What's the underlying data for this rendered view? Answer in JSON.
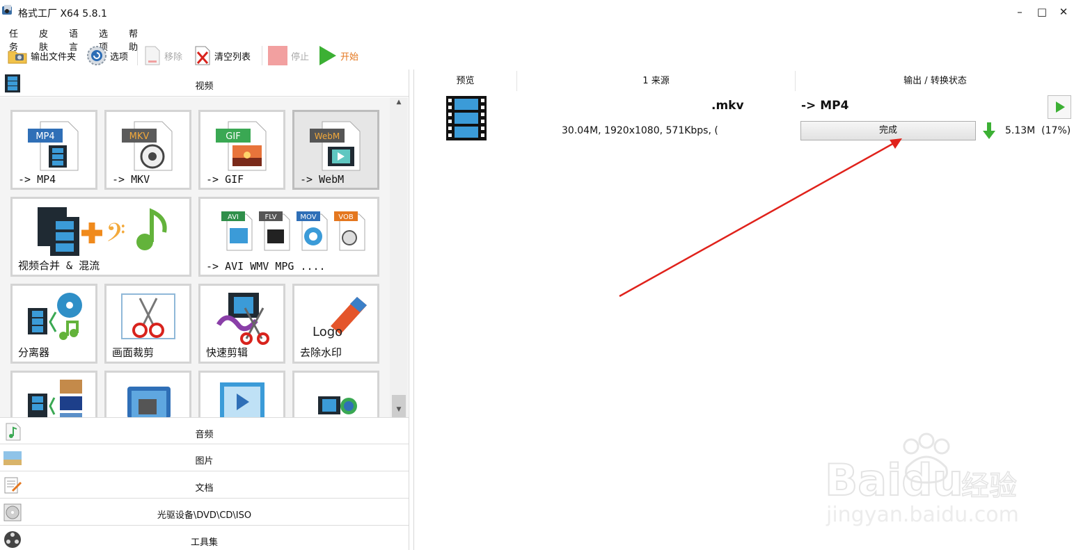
{
  "window": {
    "title": "格式工厂 X64 5.8.1",
    "controls": {
      "minimize": "–",
      "maximize": "□",
      "close": "✕"
    }
  },
  "menu": [
    "任务",
    "皮肤",
    "语言",
    "选项",
    "帮助"
  ],
  "toolbar": {
    "output_folder": "输出文件夹",
    "options": "选项",
    "remove": "移除",
    "clear_list": "清空列表",
    "stop": "停止",
    "start": "开始"
  },
  "categories": {
    "video": "视频",
    "audio": "音频",
    "image": "图片",
    "document": "文档",
    "disc": "光驱设备\\DVD\\CD\\ISO",
    "tools": "工具集"
  },
  "tiles": {
    "mp4": {
      "badge": "MP4",
      "label": "-> MP4"
    },
    "mkv": {
      "badge": "MKV",
      "label": "-> MKV"
    },
    "gif": {
      "badge": "GIF",
      "label": "-> GIF"
    },
    "webm": {
      "badge": "WebM",
      "label": "-> WebM"
    },
    "merge": {
      "label": "视频合并 & 混流"
    },
    "other_formats": {
      "badges": [
        "AVI",
        "FLV",
        "MOV",
        "VOB"
      ],
      "label": "-> AVI WMV MPG ...."
    },
    "splitter": {
      "label": "分离器"
    },
    "crop": {
      "label": "画面裁剪"
    },
    "quick_clip": {
      "label": "快速剪辑"
    },
    "remove_logo": {
      "label": "去除水印",
      "logo_text": "Logo"
    }
  },
  "task_list": {
    "columns": {
      "preview": "预览",
      "source": "1 来源",
      "output": "输出 / 转换状态"
    },
    "rows": [
      {
        "source_name": ".mkv",
        "source_info": "30.04M, 1920x1080, 571Kbps, (",
        "output_format": "-> MP4",
        "status": "完成",
        "output_size": "5.13M",
        "output_ratio": "(17%)"
      }
    ]
  },
  "colors": {
    "accent_orange": "#e4771f",
    "play_green": "#3cb034",
    "annotation_red": "#e0221b",
    "stop_red": "#f2a0a0"
  },
  "watermark": {
    "brand": "Baidu",
    "brand_cn": "经验",
    "url": "jingyan.baidu.com"
  }
}
